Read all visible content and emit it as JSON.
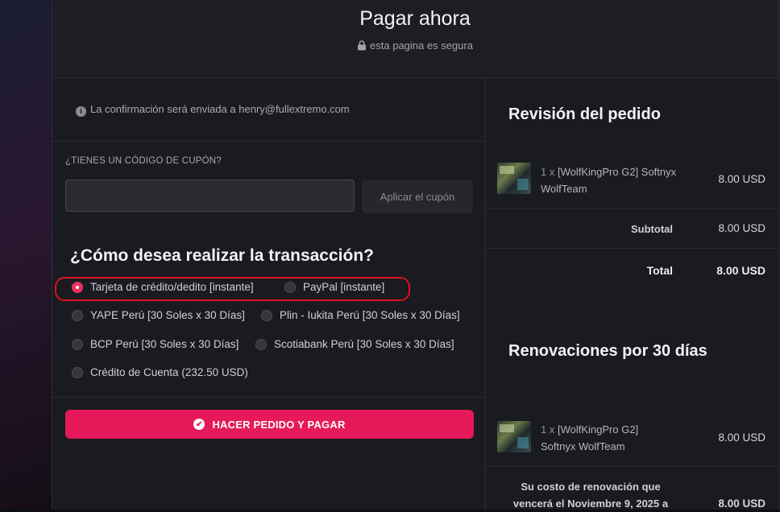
{
  "header": {
    "title": "Pagar ahora",
    "secure_text": "esta pagina es segura"
  },
  "confirmation": {
    "text": "La confirmación será enviada a henry@fullextremo.com"
  },
  "coupon": {
    "label": "¿TIENES UN CÓDIGO DE CUPÓN?",
    "input_value": "",
    "button_label": "Aplicar el cupón"
  },
  "payment": {
    "title": "¿Cómo desea realizar la transacción?",
    "options": [
      {
        "label": "Tarjeta de crédito/dedito [instante]",
        "selected": true
      },
      {
        "label": "PayPal [instante]",
        "selected": false
      },
      {
        "label": "YAPE Perú [30 Soles x 30 Días]",
        "selected": false
      },
      {
        "label": "Plin - Iukita Perú [30 Soles x 30 Días]",
        "selected": false
      },
      {
        "label": "BCP Perú [30 Soles x 30 Días]",
        "selected": false
      },
      {
        "label": "Scotiabank Perú [30 Soles x 30 Días]",
        "selected": false
      },
      {
        "label": "Crédito de Cuenta (232.50 USD)",
        "selected": false
      }
    ],
    "submit_label": "HACER PEDIDO Y PAGAR"
  },
  "review": {
    "title": "Revisión del pedido",
    "item": {
      "qty": "1 x",
      "name": "[WolfKingPro G2] Softnyx WolfTeam",
      "price": "8.00 USD"
    },
    "subtotal_label": "Subtotal",
    "subtotal_value": "8.00 USD",
    "total_label": "Total",
    "total_value": "8.00 USD"
  },
  "renewals": {
    "title": "Renovaciones por 30 días",
    "item": {
      "qty": "1 x",
      "name": "[WolfKingPro G2] Softnyx WolfTeam",
      "price": "8.00 USD"
    },
    "note": "Su costo de renovación que vencerá el Noviembre 9, 2025 a",
    "note_value": "8.00 USD"
  },
  "colors": {
    "accent": "#e6195a",
    "highlight_annotation": "#e0101a"
  }
}
